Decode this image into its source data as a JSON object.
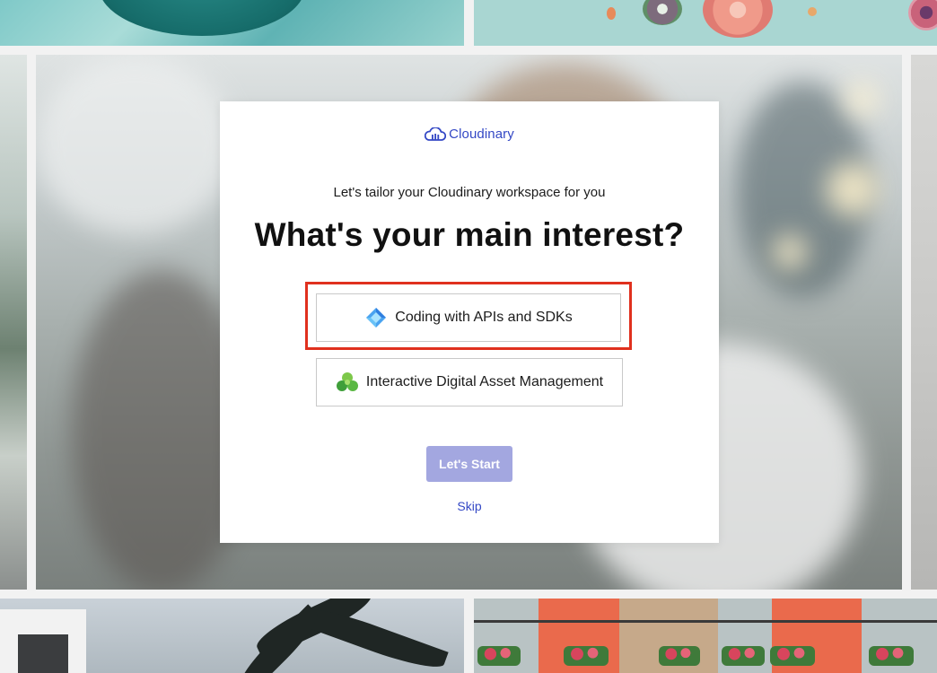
{
  "modal": {
    "logo_text": "Cloudinary",
    "subtitle": "Let's tailor your Cloudinary workspace for you",
    "headline": "What's your main interest?",
    "options": [
      {
        "label": "Coding with APIs and SDKs",
        "icon": "diamond-code-icon",
        "highlighted": true
      },
      {
        "label": "Interactive Digital Asset Management",
        "icon": "cubes-icon",
        "highlighted": false
      }
    ],
    "start_label": "Let's Start",
    "skip_label": "Skip"
  },
  "colors": {
    "brand": "#3448c5",
    "start_button": "#a3a7e0",
    "highlight_border": "#e0301e"
  }
}
